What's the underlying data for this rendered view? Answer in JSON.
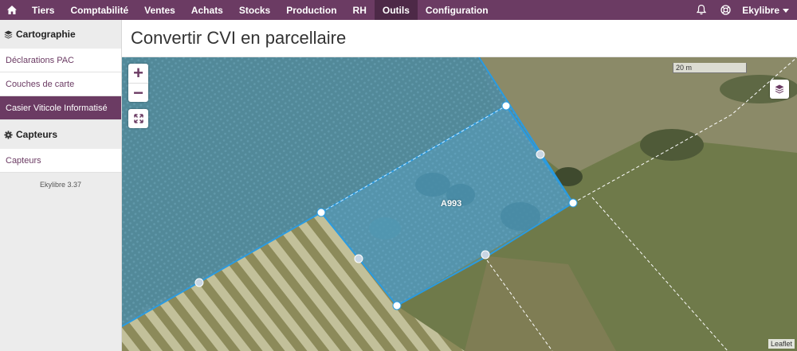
{
  "nav": {
    "items": [
      "Tiers",
      "Comptabilité",
      "Ventes",
      "Achats",
      "Stocks",
      "Production",
      "RH",
      "Outils",
      "Configuration"
    ],
    "active": "Outils",
    "user": "Ekylibre"
  },
  "sidebar": {
    "sections": [
      {
        "title": "Cartographie",
        "icon": "layers-icon",
        "items": [
          "Déclarations PAC",
          "Couches de carte",
          "Casier Viticole Informatisé"
        ]
      },
      {
        "title": "Capteurs",
        "icon": "gear-icon",
        "items": [
          "Capteurs"
        ]
      }
    ],
    "active_item": "Casier Viticole Informatisé",
    "version": "Ekylibre 3.37"
  },
  "page": {
    "title": "Convertir CVI en parcellaire"
  },
  "map": {
    "zoom_in": "+",
    "zoom_out": "−",
    "scale_label": "20 m",
    "parcel_label": "A993",
    "attribution": "Leaflet"
  },
  "colors": {
    "brand": "#6b3b63",
    "parcel_fill": "#4aa3d8",
    "parcel_edge": "#2b9be0"
  }
}
